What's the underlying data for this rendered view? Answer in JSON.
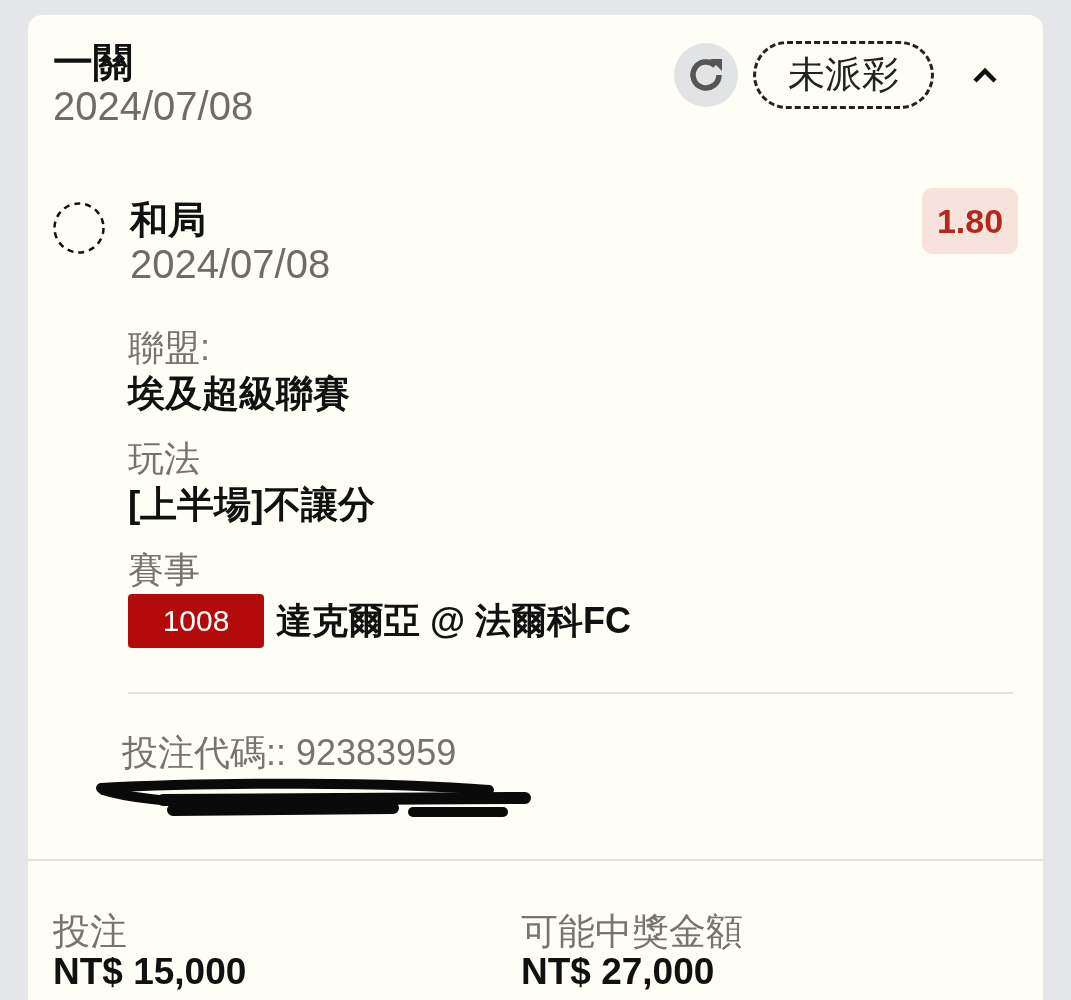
{
  "bet": {
    "type": "一關",
    "date": "2024/07/08",
    "status": {
      "label": "未派彩",
      "kind": "pending"
    },
    "expanded": true
  },
  "selection": {
    "name": "和局",
    "date": "2024/07/08",
    "pending": true,
    "odds": "1.80"
  },
  "fields": [
    {
      "kind": "text",
      "label": "聯盟:",
      "value": "埃及超級聯賽"
    },
    {
      "kind": "text",
      "label": "玩法",
      "value": "[上半場]不讓分"
    },
    {
      "kind": "match",
      "label": "賽事",
      "match_no": "1008",
      "value": "達克爾亞 @ 法爾科FC"
    }
  ],
  "bet_code": "投注代碼:: 92383959",
  "summary": [
    {
      "label": "投注",
      "value": "NT$ 15,000"
    },
    {
      "label": "可能中獎金額",
      "value": "NT$ 27,000"
    }
  ]
}
